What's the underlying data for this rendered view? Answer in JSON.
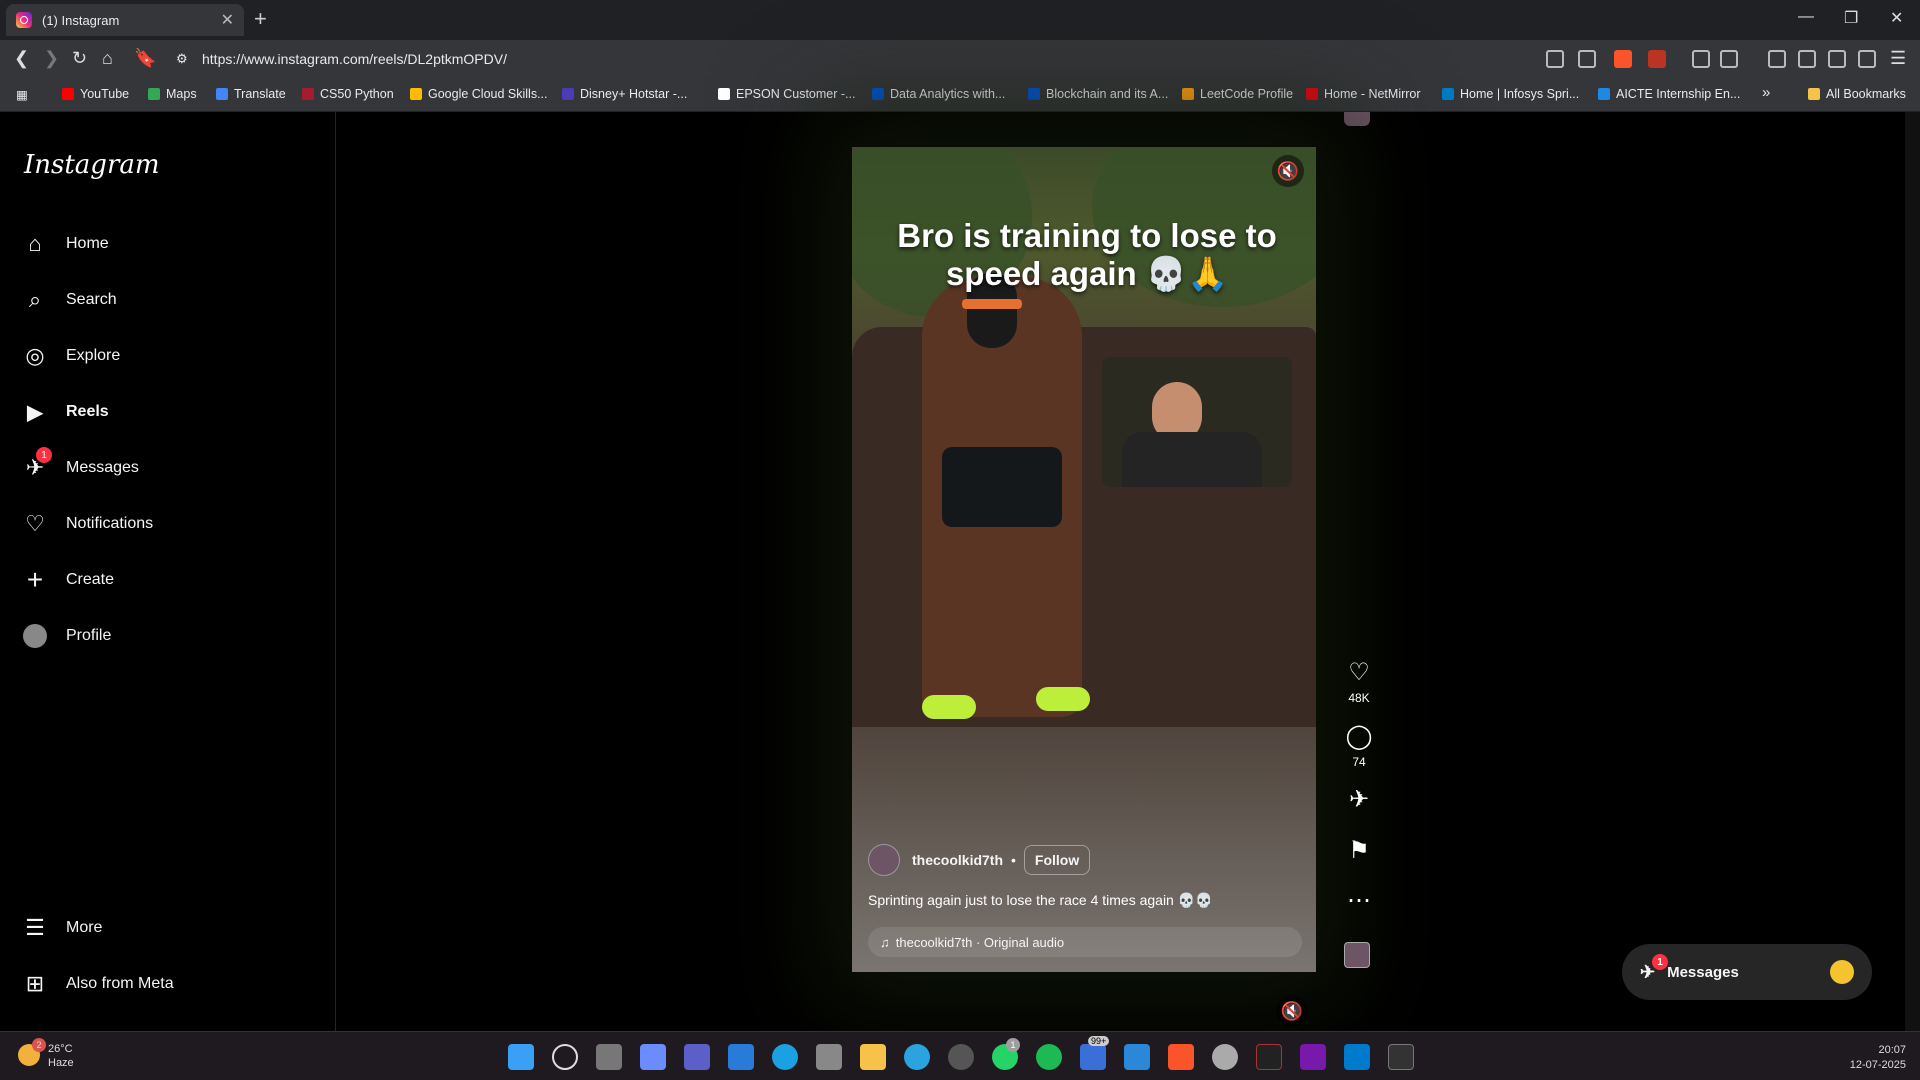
{
  "browser": {
    "tab_title": "(1) Instagram",
    "url": "https://www.instagram.com/reels/DL2ptkmOPDV/",
    "bookmarks": [
      "YouTube",
      "Maps",
      "Translate",
      "CS50 Python",
      "Google Cloud Skills...",
      "Disney+ Hotstar -...",
      "EPSON Customer -...",
      "Data Analytics with...",
      "Blockchain and its A...",
      "LeetCode Profile",
      "Home - NetMirror",
      "Home | Infosys Spri...",
      "AICTE Internship En..."
    ],
    "all_bookmarks": "All Bookmarks",
    "more_bookmarks": "»"
  },
  "sidebar": {
    "logo": "Instagram",
    "items": [
      {
        "label": "Home",
        "icon": "home-icon"
      },
      {
        "label": "Search",
        "icon": "search-icon"
      },
      {
        "label": "Explore",
        "icon": "compass-icon"
      },
      {
        "label": "Reels",
        "icon": "reels-icon"
      },
      {
        "label": "Messages",
        "icon": "messenger-icon",
        "badge": "1"
      },
      {
        "label": "Notifications",
        "icon": "heart-icon"
      },
      {
        "label": "Create",
        "icon": "plus-icon"
      },
      {
        "label": "Profile",
        "icon": "avatar"
      }
    ],
    "more": "More",
    "also_from_meta": "Also from Meta"
  },
  "reel": {
    "overlay_caption": "Bro is training to lose to speed again 💀🙏",
    "username": "thecoolkid7th",
    "separator": "•",
    "follow": "Follow",
    "description": "Sprinting again just to lose the race 4 times again 💀💀",
    "audio": "thecoolkid7th · Original audio",
    "likes": "48K",
    "comments": "74"
  },
  "messages_dock": {
    "label": "Messages",
    "badge": "1"
  },
  "taskbar": {
    "temp": "26°C",
    "condition": "Haze",
    "weather_badge": "2",
    "time": "20:07",
    "date": "12-07-2025",
    "badge_whatsapp": "1",
    "badge_99": "99+"
  }
}
